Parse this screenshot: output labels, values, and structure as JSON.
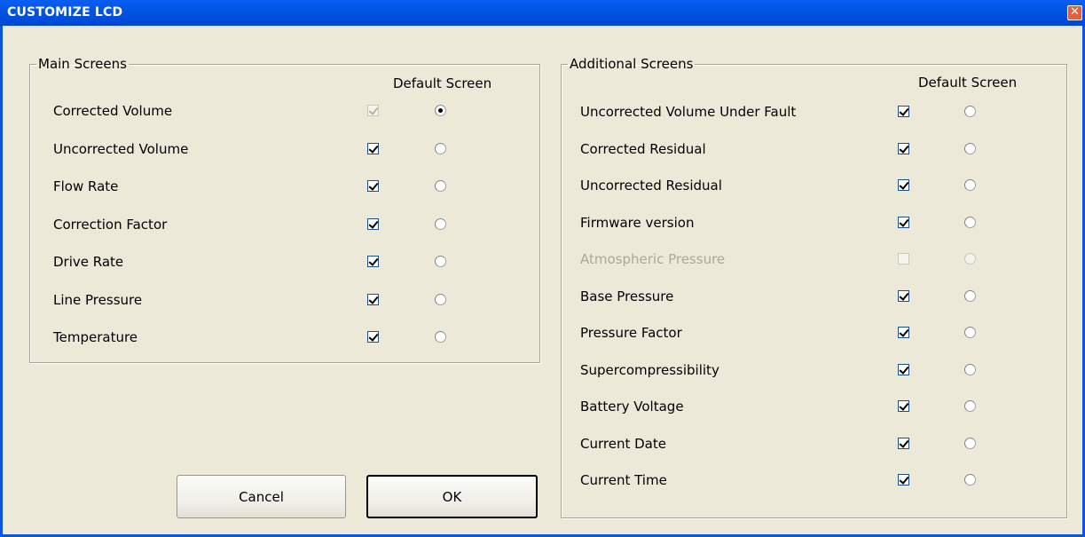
{
  "window": {
    "title": "CUSTOMIZE LCD",
    "close_glyph": "✕"
  },
  "main_screens": {
    "title": "Main Screens",
    "default_header": "Default Screen",
    "items": [
      {
        "label": "Corrected Volume",
        "checked": true,
        "checkbox_disabled": true,
        "default": true,
        "label_disabled": false
      },
      {
        "label": "Uncorrected Volume",
        "checked": true,
        "checkbox_disabled": false,
        "default": false,
        "label_disabled": false
      },
      {
        "label": "Flow Rate",
        "checked": true,
        "checkbox_disabled": false,
        "default": false,
        "label_disabled": false
      },
      {
        "label": "Correction Factor",
        "checked": true,
        "checkbox_disabled": false,
        "default": false,
        "label_disabled": false
      },
      {
        "label": "Drive Rate",
        "checked": true,
        "checkbox_disabled": false,
        "default": false,
        "label_disabled": false
      },
      {
        "label": "Line Pressure",
        "checked": true,
        "checkbox_disabled": false,
        "default": false,
        "label_disabled": false
      },
      {
        "label": "Temperature",
        "checked": true,
        "checkbox_disabled": false,
        "default": false,
        "label_disabled": false
      }
    ]
  },
  "additional_screens": {
    "title": "Additional Screens",
    "default_header": "Default Screen",
    "items": [
      {
        "label": "Uncorrected Volume Under Fault",
        "checked": true,
        "checkbox_disabled": false,
        "default": false,
        "label_disabled": false
      },
      {
        "label": "Corrected Residual",
        "checked": true,
        "checkbox_disabled": false,
        "default": false,
        "label_disabled": false
      },
      {
        "label": "Uncorrected Residual",
        "checked": true,
        "checkbox_disabled": false,
        "default": false,
        "label_disabled": false
      },
      {
        "label": "Firmware version",
        "checked": true,
        "checkbox_disabled": false,
        "default": false,
        "label_disabled": false
      },
      {
        "label": "Atmospheric Pressure",
        "checked": false,
        "checkbox_disabled": true,
        "default": false,
        "label_disabled": true
      },
      {
        "label": "Base Pressure",
        "checked": true,
        "checkbox_disabled": false,
        "default": false,
        "label_disabled": false
      },
      {
        "label": "Pressure Factor",
        "checked": true,
        "checkbox_disabled": false,
        "default": false,
        "label_disabled": false
      },
      {
        "label": "Supercompressibility",
        "checked": true,
        "checkbox_disabled": false,
        "default": false,
        "label_disabled": false
      },
      {
        "label": "Battery Voltage",
        "checked": true,
        "checkbox_disabled": false,
        "default": false,
        "label_disabled": false
      },
      {
        "label": "Current Date",
        "checked": true,
        "checkbox_disabled": false,
        "default": false,
        "label_disabled": false
      },
      {
        "label": "Current Time",
        "checked": true,
        "checkbox_disabled": false,
        "default": false,
        "label_disabled": false
      }
    ]
  },
  "buttons": {
    "cancel": "Cancel",
    "ok": "OK"
  },
  "colors": {
    "titlebar": "#0054e3",
    "dialog_bg": "#ece9d8",
    "disabled_text": "#aca899",
    "close_button": "#e0603f"
  },
  "icons": {
    "close": "close-icon"
  }
}
